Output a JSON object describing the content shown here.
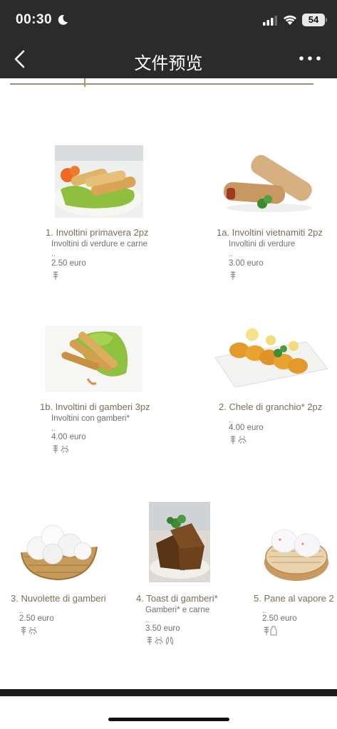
{
  "status_bar": {
    "time": "00:30",
    "battery": "54"
  },
  "nav": {
    "title": "文件预览"
  },
  "dishes": [
    {
      "name": "1. Involtini primavera 2pz",
      "desc": "Involtini di verdure e carne",
      "dots": "..",
      "price": "2.50 euro"
    },
    {
      "name": "1a. Involtini vietnamiti 2pz",
      "desc": "Involtini di verdure",
      "dots": "..",
      "price": "3.00 euro"
    },
    {
      "name": "1b. Involtini di gamberi 3pz",
      "desc": "Involtini con gamberi*",
      "dots": "..",
      "price": "4.00 euro"
    },
    {
      "name": "2. Chele di granchio* 2pz",
      "desc": "",
      "dots": "..",
      "price": "4.00 euro"
    },
    {
      "name": "3. Nuvolette di gamberi",
      "desc": "",
      "dots": "..",
      "price": "2.50 euro"
    },
    {
      "name": "4. Toast di gamberi*",
      "desc": "Gamberi* e carne",
      "dots": "..",
      "price": "3.50 euro"
    },
    {
      "name": "5. Pane al vapore 2",
      "desc": "",
      "dots": "..",
      "price": "2.50 euro"
    }
  ],
  "icons": {
    "allergens": [
      "gluten-icon",
      "crustacean-icon",
      "soy-icon",
      "milk-icon"
    ]
  },
  "colors": {
    "bar": "#2b2b2b",
    "dish_name": "#7d6f57",
    "text": "#6f6f6f"
  }
}
